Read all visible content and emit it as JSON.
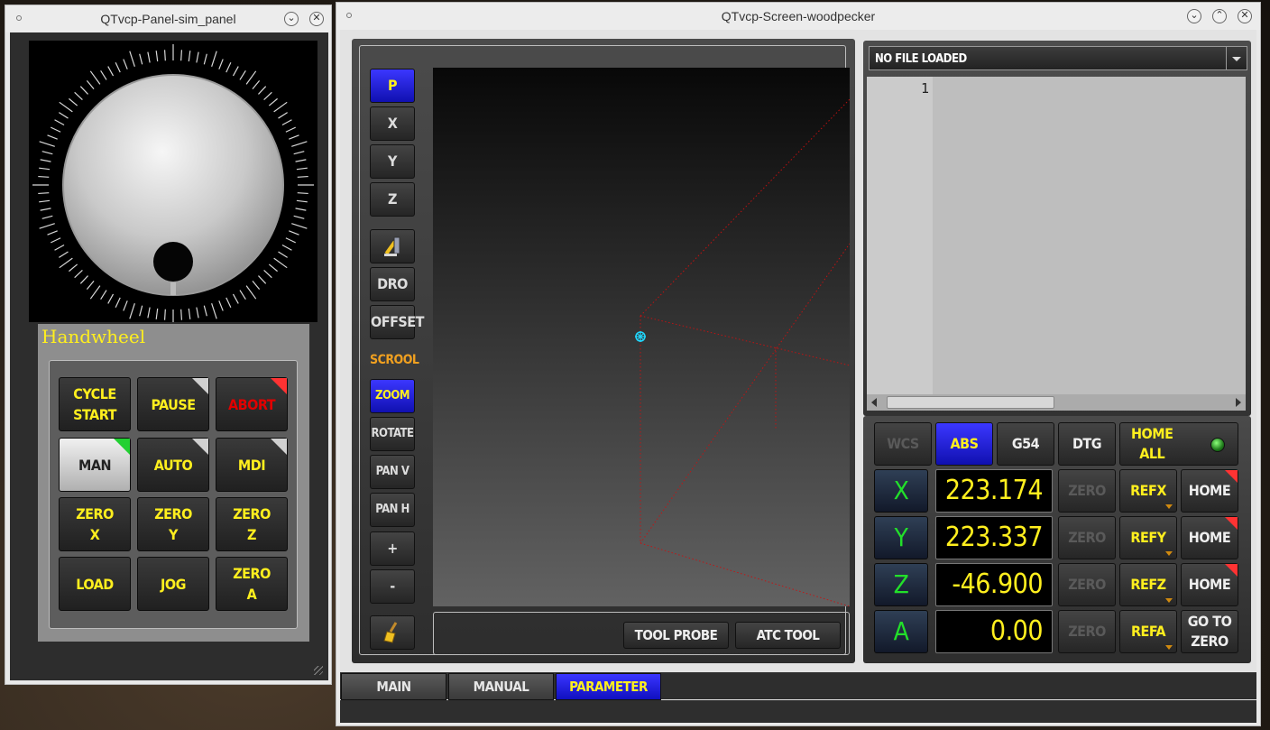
{
  "panel_window": {
    "title": "QTvcp-Panel-sim_panel",
    "group_label": "Handwheel",
    "buttons": [
      {
        "label": "CYCLE\nSTART",
        "corner": ""
      },
      {
        "label": "PAUSE",
        "corner": "gray"
      },
      {
        "label": "ABORT",
        "corner": "red"
      },
      {
        "label": "MAN",
        "corner": "green"
      },
      {
        "label": "AUTO",
        "corner": "gray"
      },
      {
        "label": "MDI",
        "corner": "gray"
      },
      {
        "label": "ZERO\nX",
        "corner": ""
      },
      {
        "label": "ZERO\nY",
        "corner": ""
      },
      {
        "label": "ZERO\nZ",
        "corner": ""
      },
      {
        "label": "LOAD",
        "corner": ""
      },
      {
        "label": "JOG",
        "corner": ""
      },
      {
        "label": "ZERO\nA",
        "corner": ""
      }
    ]
  },
  "main_window": {
    "title": "QTvcp-Screen-woodpecker",
    "sidebar": {
      "p": "P",
      "x": "X",
      "y": "Y",
      "z": "Z",
      "dro": "DRO",
      "offset": "OFFSET",
      "scrool": "SCROOL",
      "zoom": "ZOOM",
      "rotate": "ROTATE",
      "pan_v": "PAN V",
      "pan_h": "PAN H",
      "plus": "+",
      "minus": "-"
    },
    "toolbar": {
      "tool_probe": "TOOL PROBE",
      "atc_tool": "ATC TOOL"
    },
    "editor": {
      "file_combo": "NO FILE LOADED",
      "line_number": "1"
    },
    "dro": {
      "wcs": "WCS",
      "abs": "ABS",
      "g54": "G54",
      "dtg": "DTG",
      "home_all": "HOME\nALL",
      "axes": [
        {
          "name": "X",
          "value": "223.174",
          "zero": "ZERO",
          "ref": "REFX",
          "home": "HOME"
        },
        {
          "name": "Y",
          "value": "223.337",
          "zero": "ZERO",
          "ref": "REFY",
          "home": "HOME"
        },
        {
          "name": "Z",
          "value": "-46.900",
          "zero": "ZERO",
          "ref": "REFZ",
          "home": "HOME"
        },
        {
          "name": "A",
          "value": "0.00",
          "zero": "ZERO",
          "ref": "REFA",
          "home": "GO TO\nZERO"
        }
      ]
    },
    "tabs": [
      "MAIN",
      "MANUAL",
      "PARAMETER"
    ],
    "active_tab": "PARAMETER"
  },
  "colors": {
    "accent_yellow": "#ffef1e",
    "active_blue": "#1c18e0",
    "axis_green": "#22e02a",
    "abort_red": "#e00000"
  }
}
